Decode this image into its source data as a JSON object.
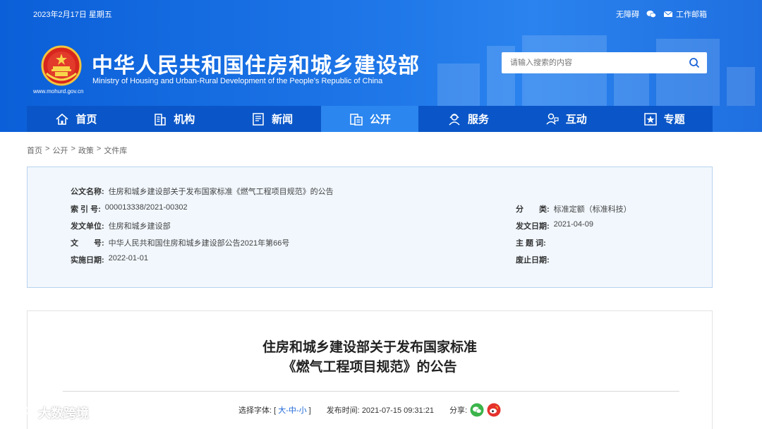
{
  "header": {
    "date": "2023年2月17日 星期五",
    "top_links": [
      {
        "label": "无障碍",
        "icon": "accessibility"
      },
      {
        "label": "",
        "icon": "wechat-icon"
      },
      {
        "label": "工作邮箱",
        "icon": "mail-icon"
      }
    ],
    "site_title": "中华人民共和国住房和城乡建设部",
    "site_subtitle": "Ministry of Housing and Urban-Rural Development of the People’s Republic of China",
    "site_url": "www.mohurd.gov.cn",
    "search_placeholder": "请输入搜索的内容"
  },
  "nav": {
    "items": [
      {
        "label": "首页",
        "icon": "home-icon"
      },
      {
        "label": "机构",
        "icon": "building-icon"
      },
      {
        "label": "新闻",
        "icon": "news-icon"
      },
      {
        "label": "公开",
        "icon": "disclosure-icon"
      },
      {
        "label": "服务",
        "icon": "service-icon"
      },
      {
        "label": "互动",
        "icon": "interaction-icon"
      },
      {
        "label": "专题",
        "icon": "topic-icon"
      }
    ],
    "active": "公开"
  },
  "breadcrumb": [
    "首页",
    "公开",
    "政策",
    "文件库"
  ],
  "info": {
    "title_label": "公文名称:",
    "title_value": "住房和城乡建设部关于发布国家标准《燃气工程项目规范》的公告",
    "index_label": "索 引 号:",
    "index_value": "000013338/2021-00302",
    "category_label": "分　　类:",
    "category_value": "标准定额（标准科技）",
    "issuer_label": "发文单位:",
    "issuer_value": "住房和城乡建设部",
    "issue_date_label": "发文日期:",
    "issue_date_value": "2021-04-09",
    "doc_no_label": "文　　号:",
    "doc_no_value": "中华人民共和国住房和城乡建设部公告2021年第66号",
    "subject_label": "主 题 词:",
    "subject_value": "",
    "effective_label": "实施日期:",
    "effective_value": "2022-01-01",
    "repeal_label": "废止日期:",
    "repeal_value": ""
  },
  "article": {
    "title_line1": "住房和城乡建设部关于发布国家标准",
    "title_line2": "《燃气工程项目规范》的公告",
    "font_size_label": "选择字体:",
    "font_large": "大",
    "font_medium": "中",
    "font_small": "小",
    "publish_label": "发布时间:",
    "publish_time": "2021-07-15 09:31:21",
    "share_label": "分享:"
  },
  "watermark": "大数跨境",
  "colors": {
    "header_blue": "#1c74e6",
    "nav_blue": "#0a56c8",
    "nav_active": "#2b86ef",
    "panel_bg": "#f1f7fd",
    "wechat_green": "#3bb44a",
    "weibo_red": "#e5322d"
  }
}
